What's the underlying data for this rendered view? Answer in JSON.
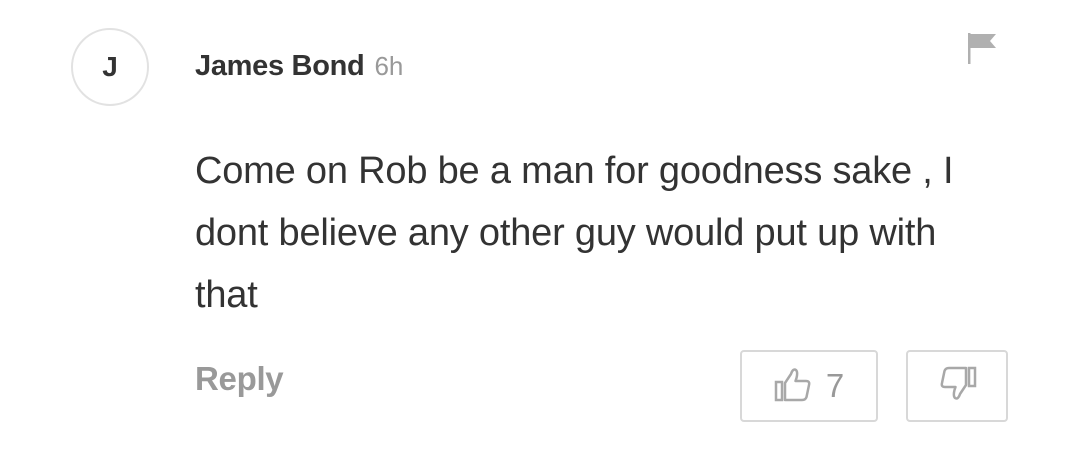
{
  "comment": {
    "avatar_initial": "J",
    "author": "James Bond",
    "time": "6h",
    "text": "Come on Rob be a man for goodness sake , I dont believe any other guy would put up with that",
    "reply_label": "Reply",
    "upvote_count": "7"
  },
  "icons": {
    "flag": "flag-icon",
    "thumbs_up": "thumbs-up-icon",
    "thumbs_down": "thumbs-down-icon"
  },
  "colors": {
    "text": "#333333",
    "muted": "#999999",
    "border": "#d8d8d8"
  }
}
